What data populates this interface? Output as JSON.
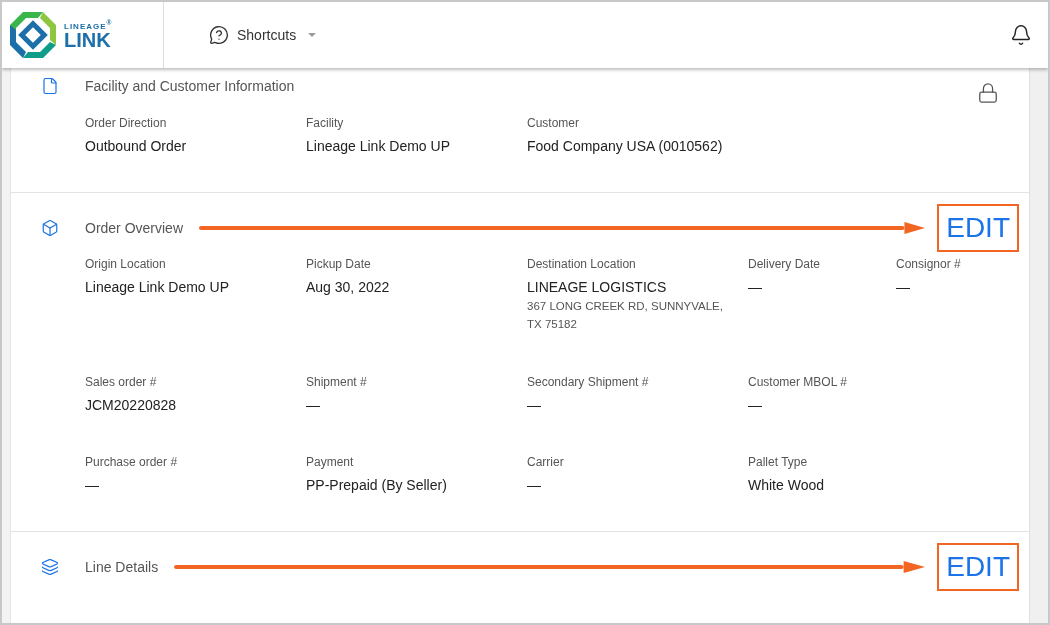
{
  "header": {
    "logo_top": "LINEAGE",
    "logo_mark": "®",
    "logo_bottom": "LINK",
    "shortcuts": "Shortcuts"
  },
  "sections": [
    {
      "kind": "file",
      "title": "Facility and Customer Information",
      "locked": true,
      "rows": [
        [
          {
            "label": "Order Direction",
            "value": "Outbound Order"
          },
          {
            "label": "Facility",
            "value": "Lineage Link Demo UP"
          },
          {
            "label": "Customer",
            "value": "Food Company USA (0010562)"
          }
        ]
      ]
    },
    {
      "kind": "box",
      "title": "Order Overview",
      "locked": false,
      "annotation": "EDIT",
      "rows": [
        [
          {
            "label": "Origin Location",
            "value": "Lineage Link Demo UP"
          },
          {
            "label": "Pickup Date",
            "value": "Aug 30, 2022"
          },
          {
            "label": "Destination Location",
            "value": "LINEAGE LOGISTICS",
            "detail": "367 LONG CREEK RD, SUNNYVALE, TX 75182"
          },
          {
            "label": "Delivery Date",
            "value": "—"
          },
          {
            "label": "Consignor #",
            "value": "—"
          }
        ],
        [
          {
            "label": "Sales order #",
            "value": "JCM20220828"
          },
          {
            "label": "Shipment #",
            "value": "—"
          },
          {
            "label": "Secondary Shipment #",
            "value": "—"
          },
          {
            "label": "Customer MBOL #",
            "value": "—"
          }
        ],
        [
          {
            "label": "Purchase order #",
            "value": "—"
          },
          {
            "label": "Payment",
            "value": "PP-Prepaid (By Seller)"
          },
          {
            "label": "Carrier",
            "value": "—"
          },
          {
            "label": "Pallet Type",
            "value": "White Wood"
          }
        ]
      ]
    },
    {
      "kind": "layers",
      "title": "Line Details",
      "locked": false,
      "annotation": "EDIT"
    }
  ]
}
